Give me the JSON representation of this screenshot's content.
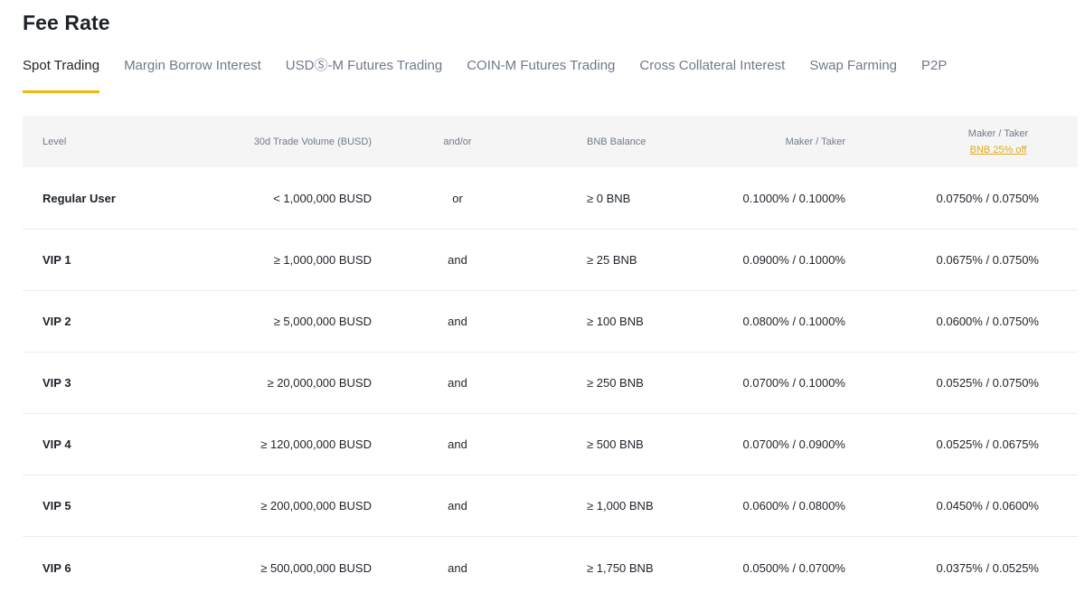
{
  "page": {
    "title": "Fee Rate"
  },
  "tabs": [
    {
      "label": "Spot Trading",
      "active": true
    },
    {
      "label": "Margin Borrow Interest",
      "active": false
    },
    {
      "label": "USDⓈ-M Futures Trading",
      "active": false
    },
    {
      "label": "COIN-M Futures Trading",
      "active": false
    },
    {
      "label": "Cross Collateral Interest",
      "active": false
    },
    {
      "label": "Swap Farming",
      "active": false
    },
    {
      "label": "P2P",
      "active": false
    }
  ],
  "table": {
    "headers": {
      "level": "Level",
      "volume": "30d Trade Volume (BUSD)",
      "andor": "and/or",
      "bnb": "BNB Balance",
      "maker_taker": "Maker / Taker",
      "maker_taker_bnb": "Maker / Taker",
      "bnb_discount": "BNB 25% off"
    },
    "rows": [
      {
        "level": "Regular User",
        "volume": "< 1,000,000 BUSD",
        "andor": "or",
        "bnb": "≥ 0 BNB",
        "maker_taker": "0.1000% / 0.1000%",
        "maker_taker_bnb": "0.0750% / 0.0750%"
      },
      {
        "level": "VIP 1",
        "volume": "≥ 1,000,000 BUSD",
        "andor": "and",
        "bnb": "≥ 25 BNB",
        "maker_taker": "0.0900% / 0.1000%",
        "maker_taker_bnb": "0.0675% / 0.0750%"
      },
      {
        "level": "VIP 2",
        "volume": "≥ 5,000,000 BUSD",
        "andor": "and",
        "bnb": "≥ 100 BNB",
        "maker_taker": "0.0800% / 0.1000%",
        "maker_taker_bnb": "0.0600% / 0.0750%"
      },
      {
        "level": "VIP 3",
        "volume": "≥ 20,000,000 BUSD",
        "andor": "and",
        "bnb": "≥ 250 BNB",
        "maker_taker": "0.0700% / 0.1000%",
        "maker_taker_bnb": "0.0525% / 0.0750%"
      },
      {
        "level": "VIP 4",
        "volume": "≥ 120,000,000 BUSD",
        "andor": "and",
        "bnb": "≥ 500 BNB",
        "maker_taker": "0.0700% / 0.0900%",
        "maker_taker_bnb": "0.0525% / 0.0675%"
      },
      {
        "level": "VIP 5",
        "volume": "≥ 200,000,000 BUSD",
        "andor": "and",
        "bnb": "≥ 1,000 BNB",
        "maker_taker": "0.0600% / 0.0800%",
        "maker_taker_bnb": "0.0450% / 0.0600%"
      },
      {
        "level": "VIP 6",
        "volume": "≥ 500,000,000 BUSD",
        "andor": "and",
        "bnb": "≥ 1,750 BNB",
        "maker_taker": "0.0500% / 0.0700%",
        "maker_taker_bnb": "0.0375% / 0.0525%"
      }
    ]
  },
  "colors": {
    "accent": "#f0b90b",
    "discount_text": "#e6a817",
    "header_bg": "#f5f5f5",
    "text_primary": "#1e2329",
    "text_secondary": "#707a8a"
  }
}
